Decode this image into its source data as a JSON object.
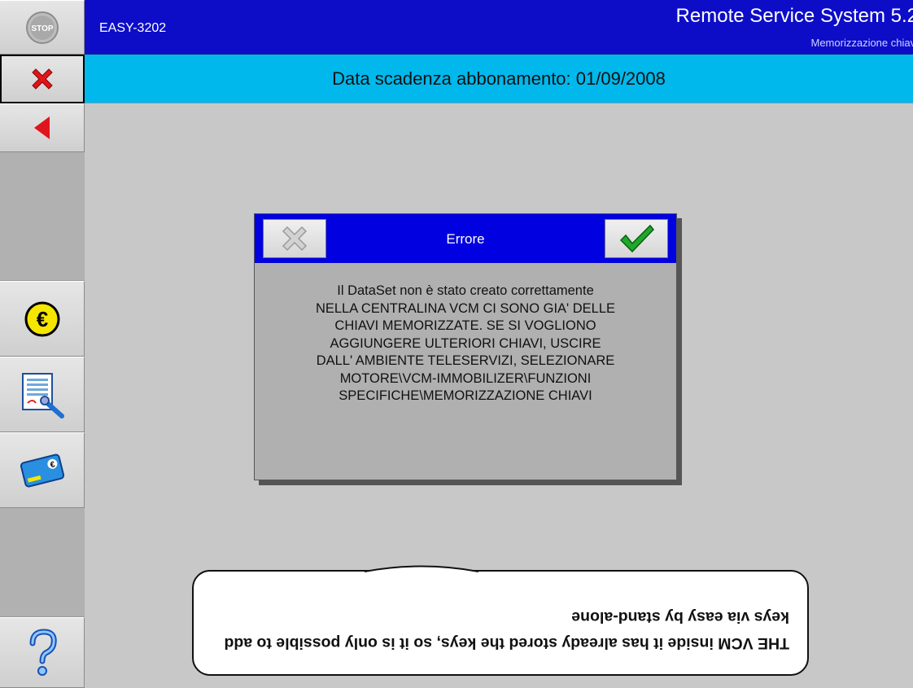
{
  "header": {
    "code": "EASY-3202",
    "title": "Remote Service System 5.2",
    "subtitle": "Memorizzazione chiavi"
  },
  "subheader": {
    "expiry": "Data scadenza abbonamento: 01/09/2008"
  },
  "sidebar": {
    "stop_label": "STOP",
    "euro_symbol": "€"
  },
  "dialog": {
    "title": "Errore",
    "message_lines": [
      "Il DataSet non è stato creato correttamente",
      "NELLA CENTRALINA VCM CI SONO GIA' DELLE",
      "CHIAVI MEMORIZZATE. SE SI VOGLIONO",
      "AGGIUNGERE ULTERIORI CHIAVI, USCIRE",
      "DALL' AMBIENTE TELESERVIZI, SELEZIONARE",
      "MOTORE\\VCM-IMMOBILIZER\\FUNZIONI",
      "SPECIFICHE\\MEMORIZZAZIONE CHIAVI"
    ]
  },
  "callout": {
    "text": "THE VCM inside it has already stored the keys, so it is only possible to add keys via easy by stand-alone"
  },
  "colors": {
    "header_blue": "#0d0dc8",
    "subbar_cyan": "#00b8ec",
    "dialog_header": "#0000e0",
    "background": "#c8c8c8"
  }
}
